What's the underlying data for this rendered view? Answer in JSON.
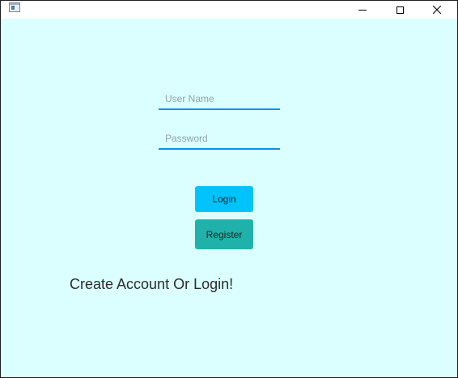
{
  "window": {
    "icon": "app-window-icon",
    "controls": {
      "minimize_icon": "minimize-icon",
      "maximize_icon": "maximize-icon",
      "close_icon": "close-icon"
    }
  },
  "login_form": {
    "username_placeholder": "User Name",
    "username_value": "",
    "password_placeholder": "Password",
    "password_value": "",
    "login_label": "Login",
    "register_label": "Register"
  },
  "status_message": "Create Account Or Login!",
  "colors": {
    "background": "#dbfffe",
    "field_underline": "#0a90e8",
    "login_button": "#00c3fb",
    "register_button": "#20b2aa"
  }
}
